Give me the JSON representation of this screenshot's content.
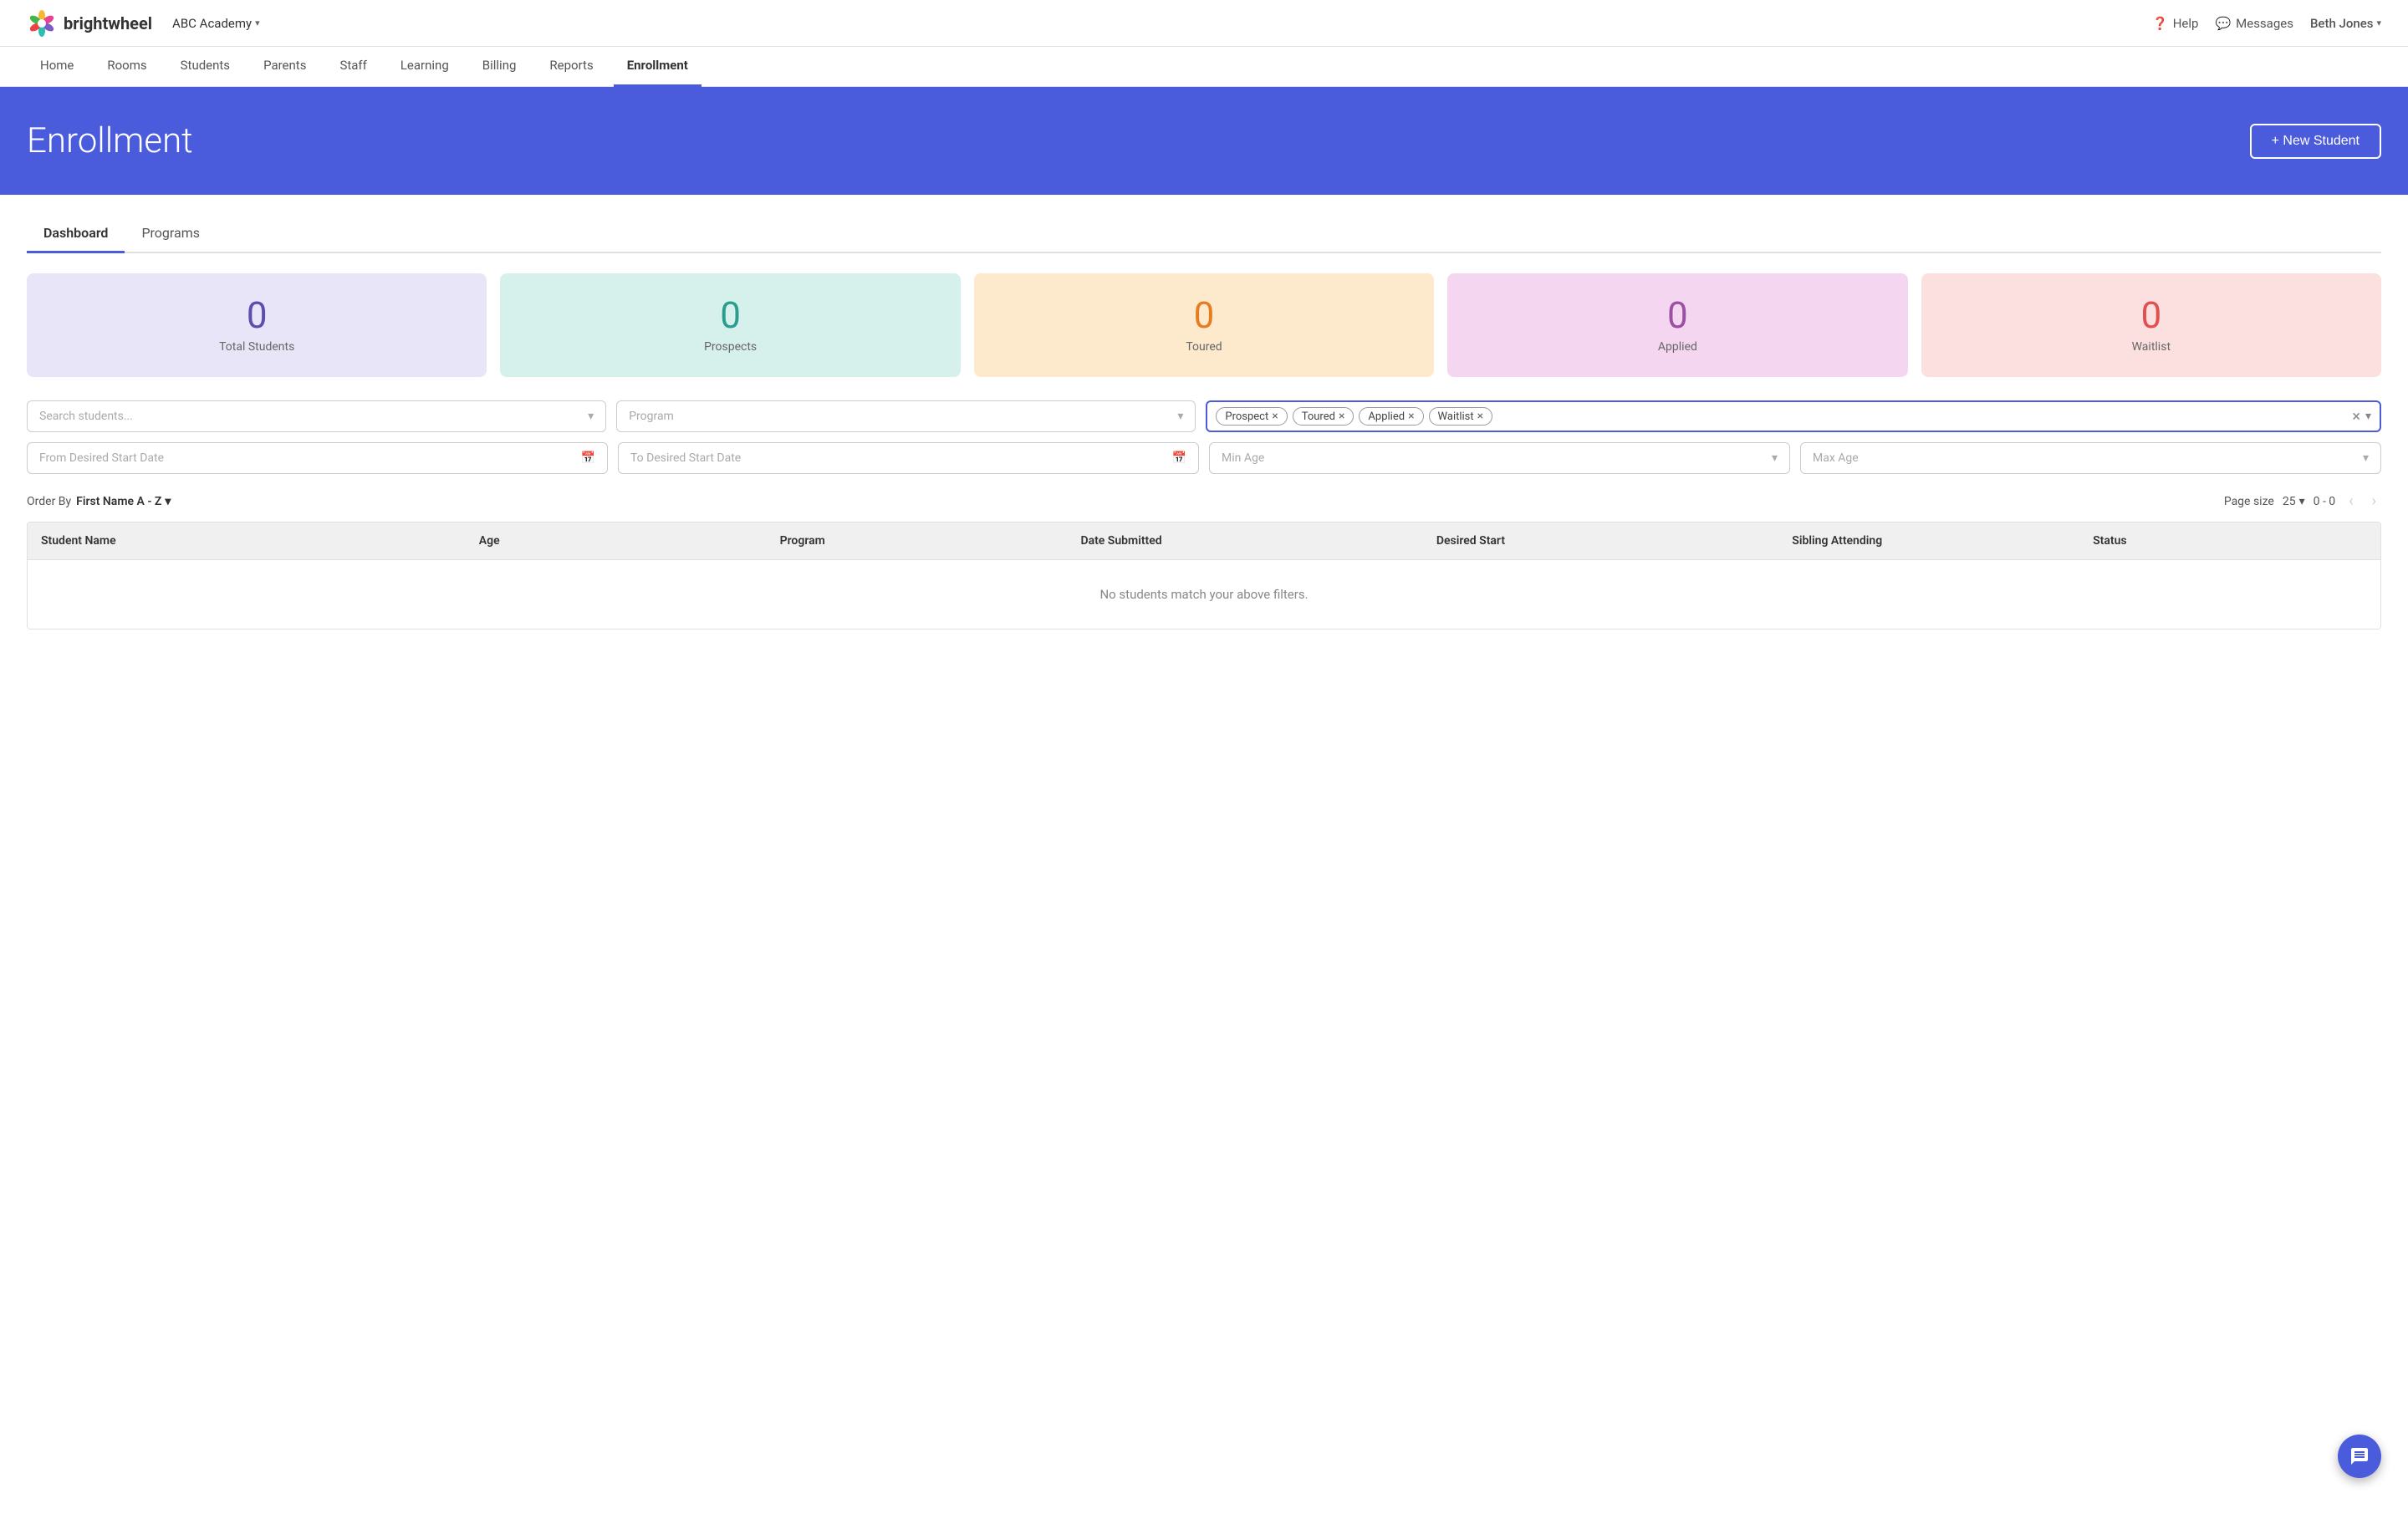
{
  "app": {
    "logo_text": "brightwheel"
  },
  "topbar": {
    "academy_name": "ABC Academy",
    "academy_caret": "▾",
    "help_label": "Help",
    "messages_label": "Messages",
    "user_name": "Beth Jones",
    "user_caret": "▾"
  },
  "nav": {
    "items": [
      {
        "id": "home",
        "label": "Home",
        "active": false
      },
      {
        "id": "rooms",
        "label": "Rooms",
        "active": false
      },
      {
        "id": "students",
        "label": "Students",
        "active": false
      },
      {
        "id": "parents",
        "label": "Parents",
        "active": false
      },
      {
        "id": "staff",
        "label": "Staff",
        "active": false
      },
      {
        "id": "learning",
        "label": "Learning",
        "active": false
      },
      {
        "id": "billing",
        "label": "Billing",
        "active": false
      },
      {
        "id": "reports",
        "label": "Reports",
        "active": false
      },
      {
        "id": "enrollment",
        "label": "Enrollment",
        "active": true
      }
    ]
  },
  "hero": {
    "title": "Enrollment",
    "new_student_button": "+ New Student"
  },
  "tabs": [
    {
      "id": "dashboard",
      "label": "Dashboard",
      "active": true
    },
    {
      "id": "programs",
      "label": "Programs",
      "active": false
    }
  ],
  "stats": [
    {
      "id": "total",
      "type": "total",
      "number": "0",
      "label": "Total Students"
    },
    {
      "id": "prospects",
      "type": "prospects",
      "number": "0",
      "label": "Prospects"
    },
    {
      "id": "toured",
      "type": "toured",
      "number": "0",
      "label": "Toured"
    },
    {
      "id": "applied",
      "type": "applied",
      "number": "0",
      "label": "Applied"
    },
    {
      "id": "waitlist",
      "type": "waitlist",
      "number": "0",
      "label": "Waitlist"
    }
  ],
  "filters": {
    "search_placeholder": "Search students...",
    "program_placeholder": "Program",
    "tags": [
      {
        "id": "prospect",
        "label": "Prospect"
      },
      {
        "id": "toured",
        "label": "Toured"
      },
      {
        "id": "applied",
        "label": "Applied"
      },
      {
        "id": "waitlist",
        "label": "Waitlist"
      }
    ],
    "from_date_placeholder": "From Desired Start Date",
    "to_date_placeholder": "To Desired Start Date",
    "min_age_placeholder": "Min Age",
    "max_age_placeholder": "Max Age"
  },
  "table_controls": {
    "order_by_label": "Order By",
    "order_by_value": "First Name A - Z",
    "order_by_caret": "▾",
    "page_size_label": "Page size",
    "page_size_value": "25",
    "page_size_caret": "▾",
    "page_range": "0 - 0"
  },
  "table": {
    "headers": [
      {
        "id": "name",
        "label": "Student Name"
      },
      {
        "id": "age",
        "label": "Age"
      },
      {
        "id": "program",
        "label": "Program"
      },
      {
        "id": "date_submitted",
        "label": "Date Submitted"
      },
      {
        "id": "desired_start",
        "label": "Desired Start"
      },
      {
        "id": "sibling",
        "label": "Sibling Attending"
      },
      {
        "id": "status",
        "label": "Status"
      }
    ],
    "no_results_text": "No students match your above filters."
  }
}
